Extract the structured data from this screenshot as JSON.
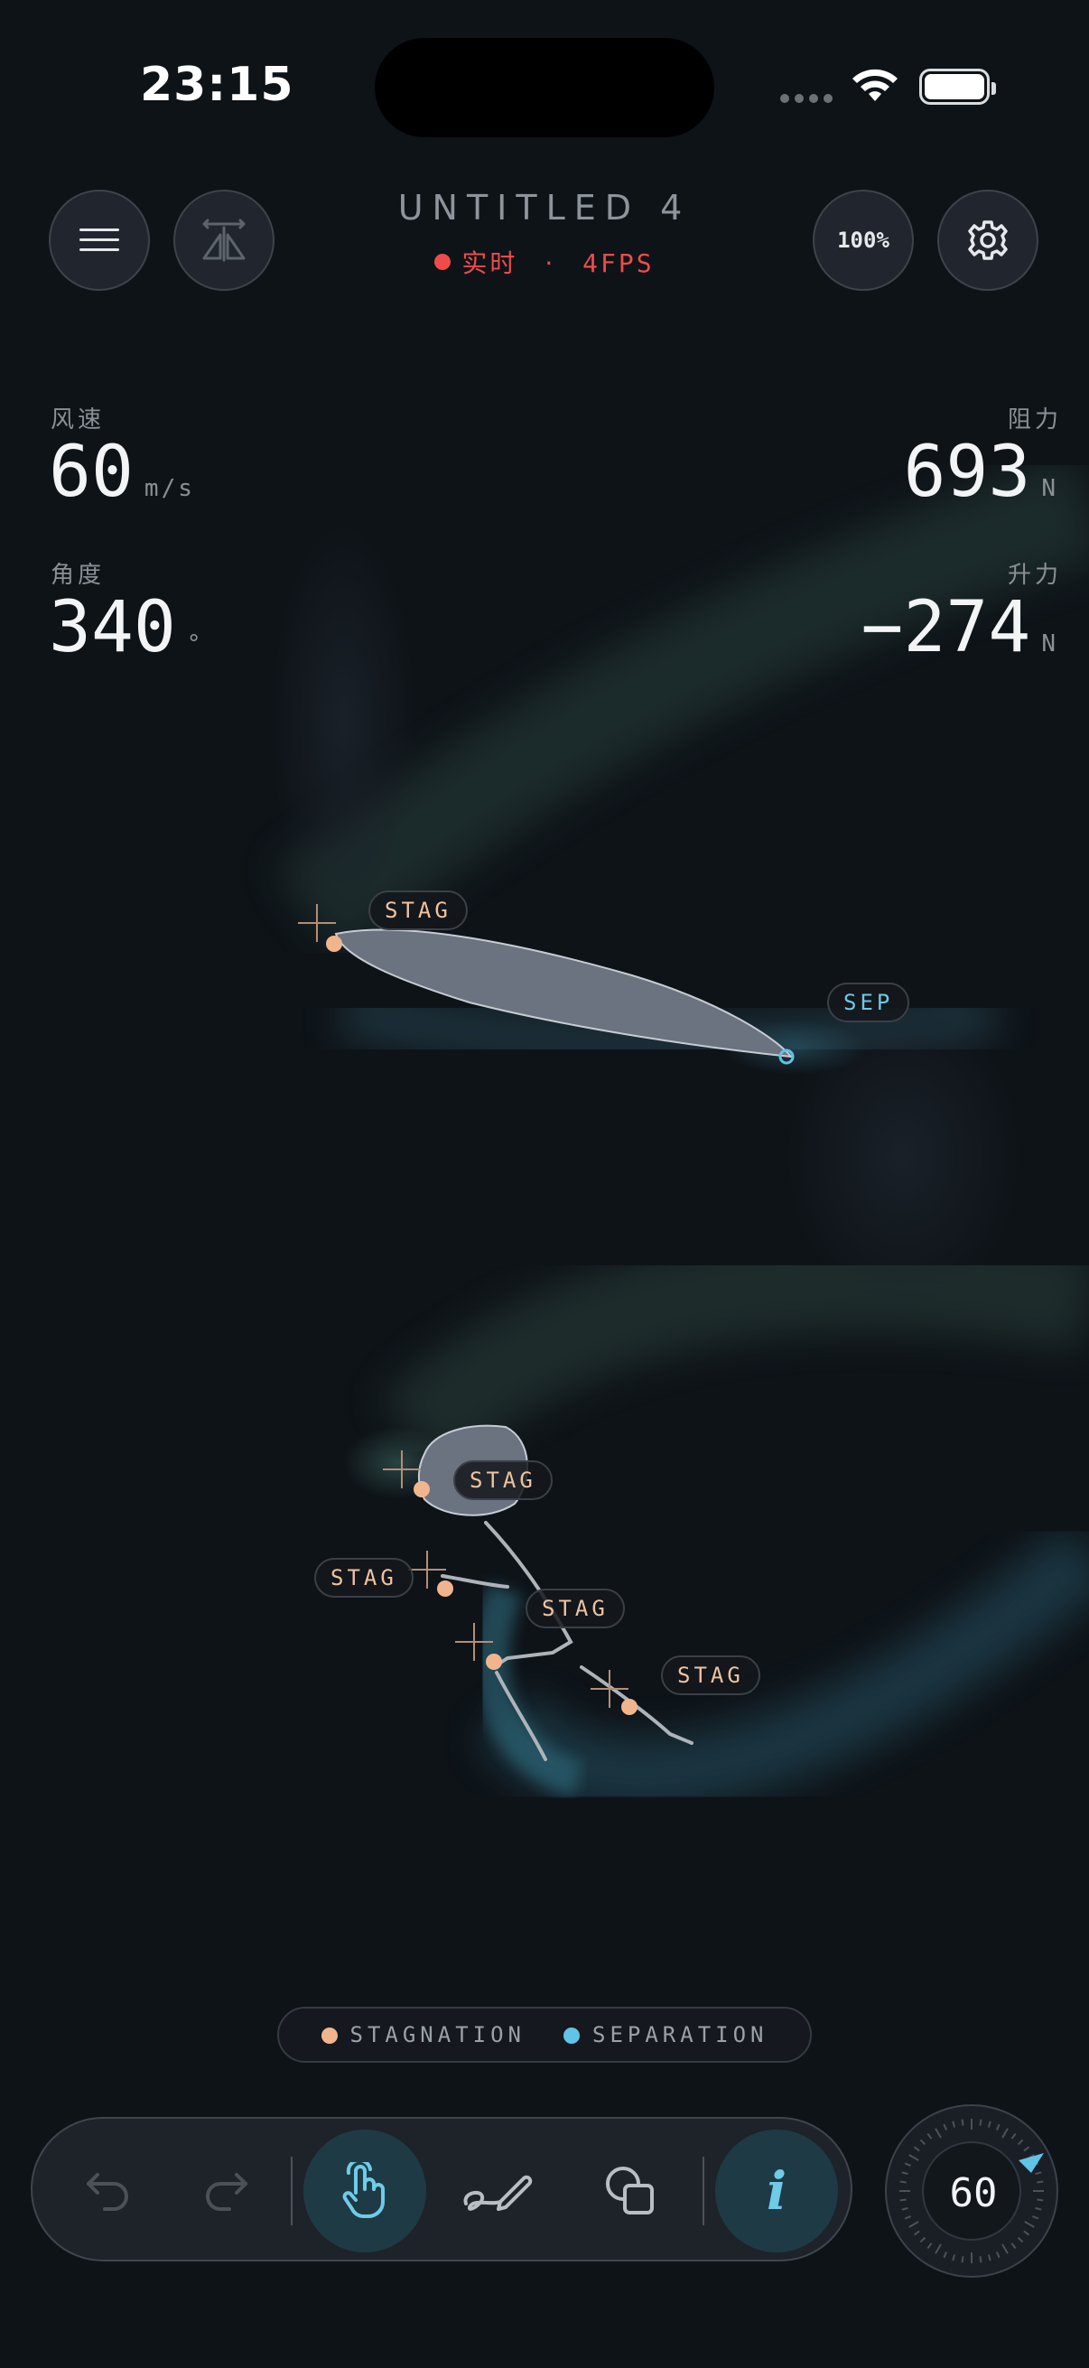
{
  "status_bar": {
    "time": "23:15"
  },
  "header": {
    "title": "UNTITLED 4",
    "live_label": "实时",
    "separator": "·",
    "fps": "4FPS",
    "zoom": "100%"
  },
  "stats": {
    "wind_speed": {
      "label": "风速",
      "value": "60",
      "unit": "m/s"
    },
    "angle": {
      "label": "角度",
      "value": "340",
      "unit": "°"
    },
    "drag": {
      "label": "阻力",
      "value": "693",
      "unit": "N"
    },
    "lift": {
      "label": "升力",
      "value": "−274",
      "unit": "N"
    }
  },
  "markers": {
    "stag": "STAG",
    "sep": "SEP"
  },
  "legend": {
    "stagnation": "STAGNATION",
    "separation": "SEPARATION"
  },
  "toolbar": {
    "undo": "undo-icon",
    "redo": "redo-icon",
    "pointer": "hand-pointer-icon",
    "draw": "pencil-draw-icon",
    "shapes": "shapes-icon",
    "info_label": "i"
  },
  "dial": {
    "value": "60"
  },
  "colors": {
    "background": "#0e1318",
    "live": "#ef4b4b",
    "stagnation": "#f1b58e",
    "separation": "#5fc4e8",
    "active_tool": "#1e3b45"
  }
}
